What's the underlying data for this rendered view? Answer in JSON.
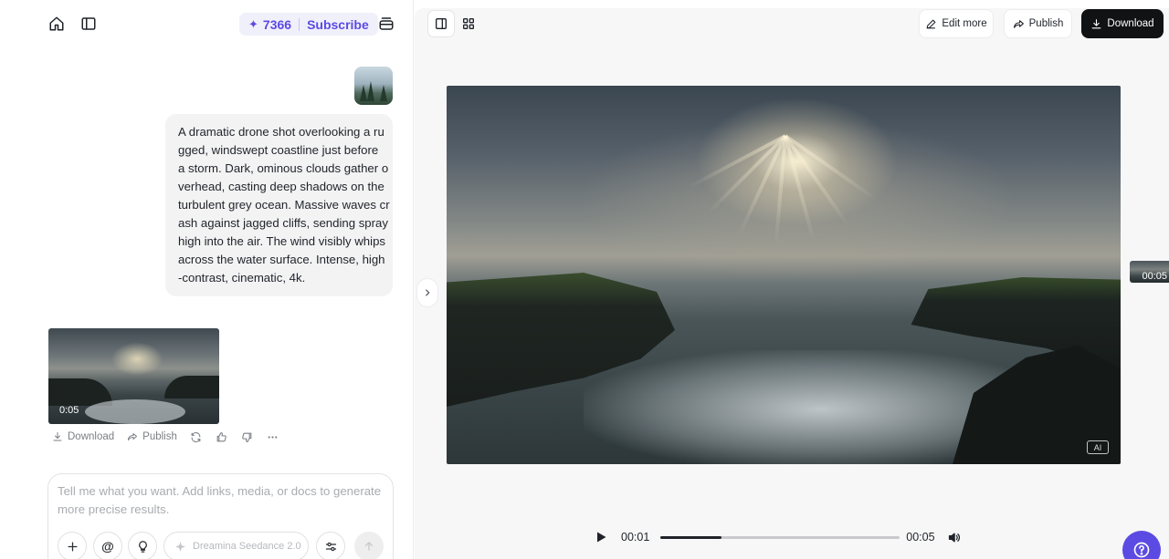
{
  "header": {
    "credits_count": "7366",
    "subscribe_label": "Subscribe"
  },
  "chat": {
    "prompt_lines": [
      "A dramatic drone shot overlooking a ru",
      "gged, windswept coastline just before",
      "a storm. Dark, ominous clouds gather o",
      "verhead, casting deep shadows on the",
      "turbulent grey ocean. Massive waves cr",
      "ash against jagged cliffs, sending spray",
      "high into the air. The wind visibly whips",
      "across the water surface. Intense, high",
      "-contrast, cinematic, 4k."
    ],
    "result_duration": "0:05",
    "actions": {
      "download_label": "Download",
      "publish_label": "Publish"
    }
  },
  "composer": {
    "placeholder": "Tell me what you want. Add links, media, or docs to generate more precise results.",
    "value": "",
    "at_symbol": "@",
    "model_name": "Dreamina Seedance 2.0"
  },
  "preview": {
    "toolbar": {
      "edit_label": "Edit more",
      "publish_label": "Publish",
      "download_label": "Download"
    },
    "ai_badge": "AI",
    "side_thumb_duration": "00:05",
    "player": {
      "current_time": "00:01",
      "total_time": "00:05",
      "progress_percent": 25.5
    }
  },
  "colors": {
    "accent": "#5b4be2",
    "accent_bg": "#f0f0fb",
    "dark_button": "#111214"
  },
  "icons": {
    "home": "home-icon",
    "sidebar": "sidebar-toggle-icon",
    "stack": "stack-icon",
    "sparkle": "sparkle-icon",
    "help": "help-icon"
  }
}
